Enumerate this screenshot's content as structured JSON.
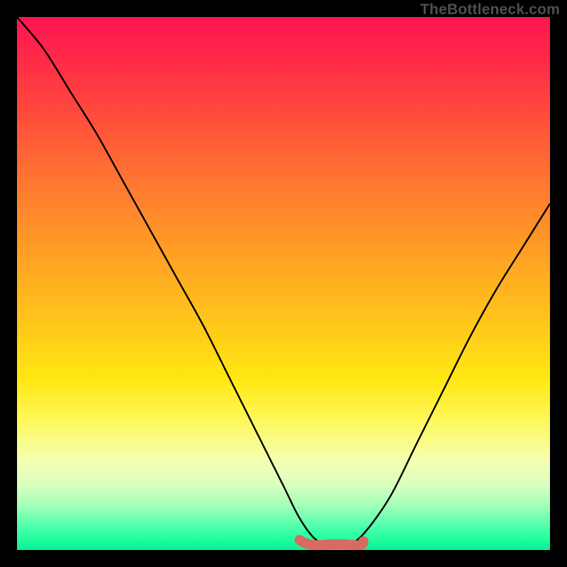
{
  "watermark": "TheBottleneck.com",
  "colors": {
    "curve_stroke": "#000000",
    "trough_marker": "#d86a63",
    "frame_background": "#000000"
  },
  "chart_data": {
    "type": "line",
    "title": "",
    "xlabel": "",
    "ylabel": "",
    "xlim": [
      0,
      100
    ],
    "ylim": [
      0,
      100
    ],
    "grid": false,
    "legend": false,
    "series": [
      {
        "name": "bottleneck-curve",
        "x": [
          0,
          5,
          10,
          15,
          20,
          25,
          30,
          35,
          40,
          45,
          50,
          53,
          56,
          59,
          62,
          65,
          70,
          75,
          80,
          85,
          90,
          95,
          100
        ],
        "values": [
          100,
          94,
          86,
          78,
          69,
          60,
          51,
          42,
          32,
          22,
          12,
          6,
          2,
          1,
          1,
          3,
          10,
          20,
          30,
          40,
          49,
          57,
          65
        ]
      }
    ],
    "annotations": [
      {
        "name": "optimal-range-marker",
        "x_start": 53,
        "x_end": 65,
        "y": 1.5,
        "style": "thick-rounded",
        "color": "#d86a63"
      }
    ]
  }
}
